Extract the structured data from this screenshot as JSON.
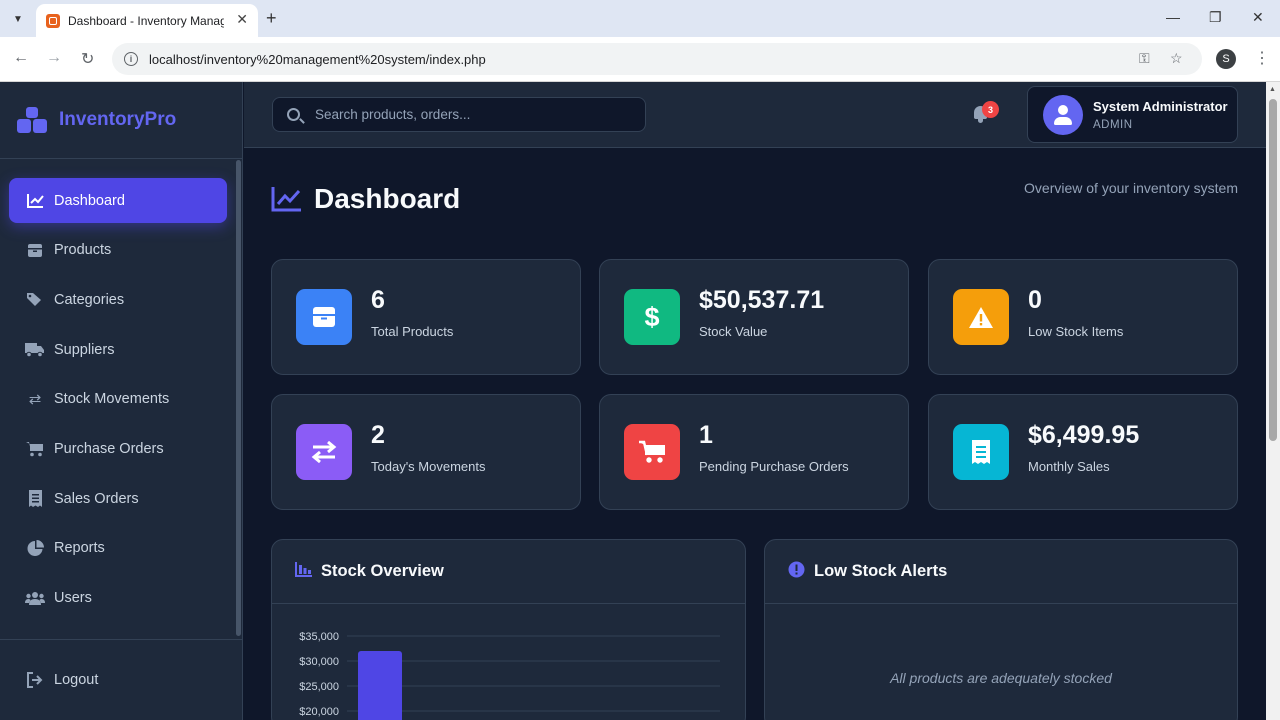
{
  "browser": {
    "tab_title": "Dashboard - Inventory Management System",
    "url": "localhost/inventory%20management%20system/index.php",
    "profile_initial": "S"
  },
  "brand": {
    "name": "InventoryPro",
    "color": "#6366f1"
  },
  "sidebar": {
    "items": [
      {
        "label": "Dashboard",
        "icon": "chart-line-icon",
        "active": true
      },
      {
        "label": "Products",
        "icon": "box-icon"
      },
      {
        "label": "Categories",
        "icon": "tags-icon"
      },
      {
        "label": "Suppliers",
        "icon": "truck-icon"
      },
      {
        "label": "Stock Movements",
        "icon": "exchange-icon"
      },
      {
        "label": "Purchase Orders",
        "icon": "cart-icon"
      },
      {
        "label": "Sales Orders",
        "icon": "receipt-icon"
      },
      {
        "label": "Reports",
        "icon": "pie-chart-icon"
      },
      {
        "label": "Users",
        "icon": "users-icon"
      }
    ],
    "logout_label": "Logout"
  },
  "topbar": {
    "search_placeholder": "Search products, orders...",
    "notification_count": "3",
    "user_name": "System Administrator",
    "user_role": "ADMIN"
  },
  "page": {
    "title": "Dashboard",
    "subtitle": "Overview of your inventory system"
  },
  "stats": [
    {
      "value": "6",
      "label": "Total Products",
      "icon": "box-icon",
      "color": "#3b82f6"
    },
    {
      "value": "$50,537.71",
      "label": "Stock Value",
      "icon": "dollar-icon",
      "color": "#10b981"
    },
    {
      "value": "0",
      "label": "Low Stock Items",
      "icon": "warning-icon",
      "color": "#f59e0b"
    },
    {
      "value": "2",
      "label": "Today's Movements",
      "icon": "exchange-icon",
      "color": "#8b5cf6"
    },
    {
      "value": "1",
      "label": "Pending Purchase Orders",
      "icon": "cart-icon",
      "color": "#ef4444"
    },
    {
      "value": "$6,499.95",
      "label": "Monthly Sales",
      "icon": "receipt-icon",
      "color": "#06b6d4"
    }
  ],
  "panels": {
    "stock_overview_title": "Stock Overview",
    "low_stock_title": "Low Stock Alerts",
    "low_stock_empty": "All products are adequately stocked"
  },
  "chart_data": {
    "type": "bar",
    "title": "Stock Overview",
    "y_ticks": [
      "$35,000",
      "$30,000",
      "$25,000",
      "$20,000"
    ],
    "ylim": [
      20000,
      35000
    ],
    "values": [
      32000
    ],
    "bar_color": "#4f46e5"
  }
}
